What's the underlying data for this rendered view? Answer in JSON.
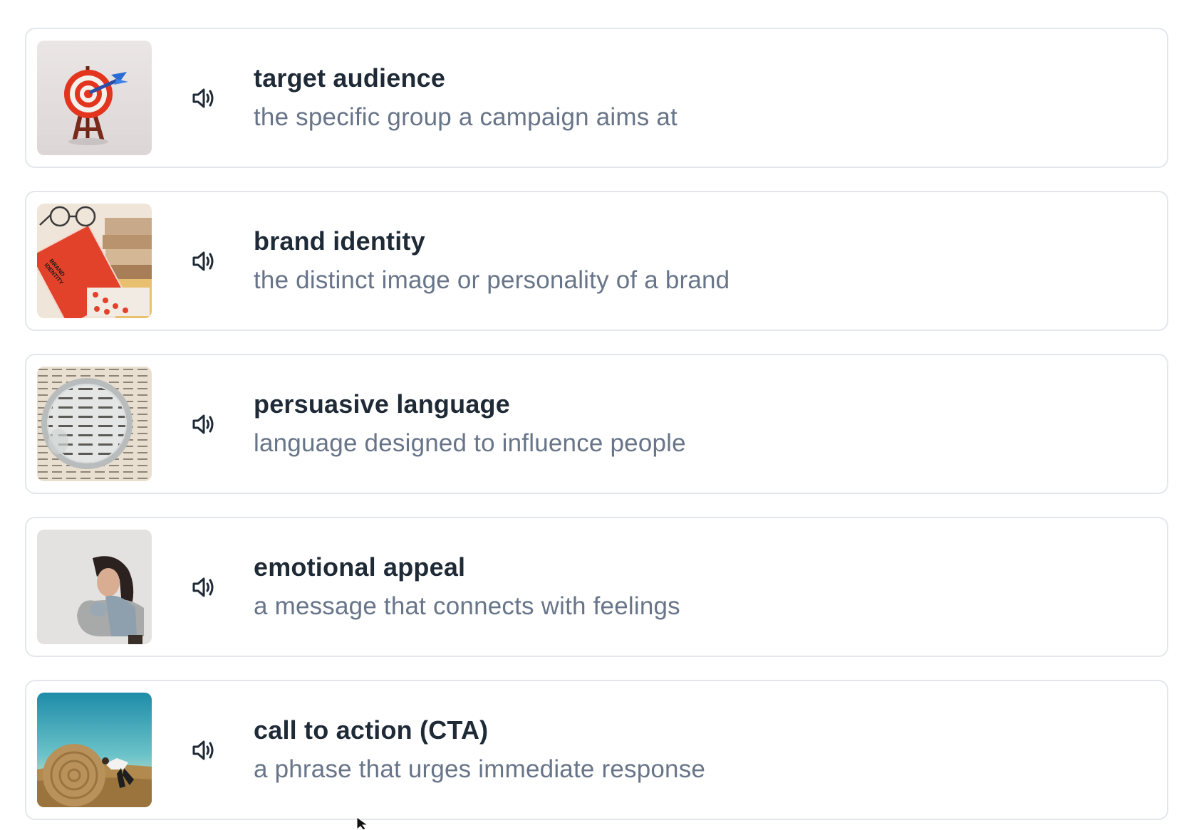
{
  "vocabulary": [
    {
      "term": "target audience",
      "definition": "the specific group a campaign aims at",
      "image": "dartboard-target-image",
      "speaker_icon": "speaker-icon"
    },
    {
      "term": "brand identity",
      "definition": "the distinct image or personality of a brand",
      "image": "brand-identity-book-image",
      "image_text": "BRAND IDENTITY",
      "speaker_icon": "speaker-icon"
    },
    {
      "term": "persuasive language",
      "definition": "language designed to influence people",
      "image": "magnifying-glass-dictionary-image",
      "speaker_icon": "speaker-icon"
    },
    {
      "term": "emotional appeal",
      "definition": "a message that connects with feelings",
      "image": "sad-woman-image",
      "speaker_icon": "speaker-icon"
    },
    {
      "term": "call to action (CTA)",
      "definition": "a phrase that urges immediate response",
      "image": "person-pushing-hay-bale-image",
      "speaker_icon": "speaker-icon"
    }
  ],
  "colors": {
    "term_text": "#1f2a37",
    "definition_text": "#687589",
    "card_border": "#e3e7ec"
  }
}
